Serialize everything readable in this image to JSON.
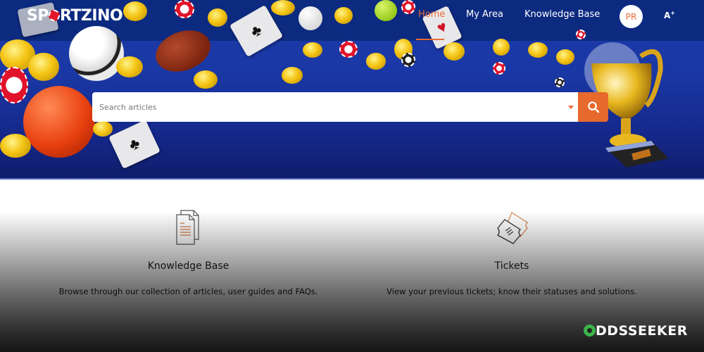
{
  "brand": {
    "logo_prefix": "SP",
    "logo_suffix": "RTZINO"
  },
  "nav": {
    "items": [
      {
        "label": "Home",
        "active": true
      },
      {
        "label": "My Area",
        "active": false
      },
      {
        "label": "Knowledge Base",
        "active": false
      }
    ],
    "avatar_initials": "PR",
    "font_size_label": "A",
    "font_size_sup": "+"
  },
  "search": {
    "placeholder": "Search articles",
    "value": ""
  },
  "tiles": [
    {
      "title": "Knowledge Base",
      "description": "Browse through our collection of articles, user guides and FAQs.",
      "icon": "documents-icon"
    },
    {
      "title": "Tickets",
      "description": "View your previous tickets; know their statuses and solutions.",
      "icon": "tickets-icon"
    }
  ],
  "watermark": {
    "prefix": "O",
    "text": "DDSSEEKER"
  },
  "colors": {
    "accent": "#e8692c",
    "header_bg": "#0c2a80",
    "hero_bg": "#1a3aa8",
    "watermark_green": "#3bb54a"
  }
}
